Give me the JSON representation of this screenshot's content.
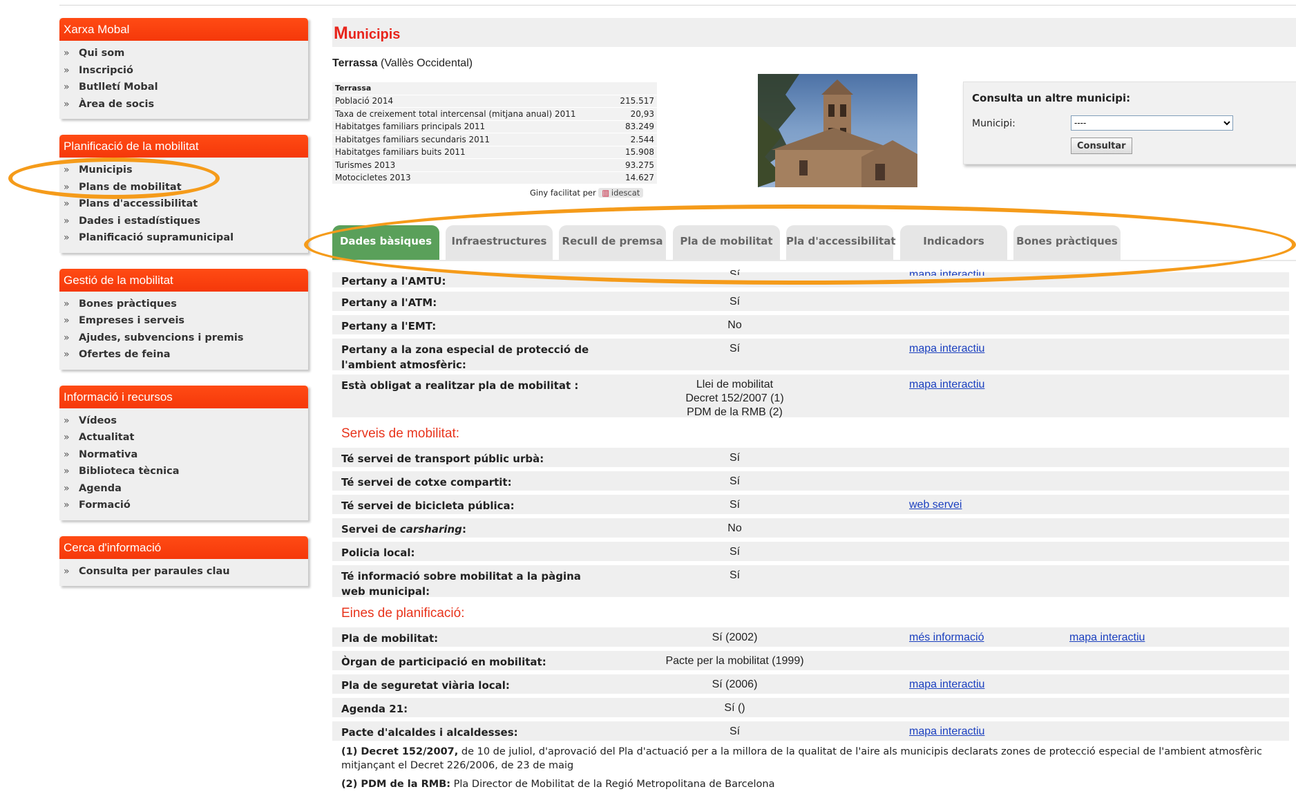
{
  "sidebar": [
    {
      "title": "Xarxa Mobal",
      "items": [
        "Qui som",
        "Inscripció",
        "Butlletí Mobal",
        "Àrea de socis"
      ]
    },
    {
      "title": "Planificació de la mobilitat",
      "items": [
        "Municipis",
        "Plans de mobilitat",
        "Plans d'accessibilitat",
        "Dades i estadístiques",
        "Planificació supramunicipal"
      ]
    },
    {
      "title": "Gestió de la mobilitat",
      "items": [
        "Bones pràctiques",
        "Empreses i serveis",
        "Ajudes, subvencions i premis",
        "Ofertes de feina"
      ]
    },
    {
      "title": "Informació i recursos",
      "items": [
        "Vídeos",
        "Actualitat",
        "Normativa",
        "Biblioteca tècnica",
        "Agenda",
        "Formació"
      ]
    },
    {
      "title": "Cerca d'informació",
      "items": [
        "Consulta per paraules clau"
      ]
    }
  ],
  "header": {
    "first": "M",
    "rest": "unicipis"
  },
  "municipality": {
    "name": "Terrassa",
    "region": "(Vallès Occidental)"
  },
  "stats": {
    "heading": "Terrassa",
    "rows": [
      {
        "label": "Població 2014",
        "value": "215.517"
      },
      {
        "label": "Taxa de creixement total intercensal (mitjana anual) 2011",
        "value": "20,93"
      },
      {
        "label": "Habitatges familiars principals 2011",
        "value": "83.249"
      },
      {
        "label": "Habitatges familiars secundaris 2011",
        "value": "2.544"
      },
      {
        "label": "Habitatges familiars buits 2011",
        "value": "15.908"
      },
      {
        "label": "Turismes 2013",
        "value": "93.275"
      },
      {
        "label": "Motocicletes 2013",
        "value": "14.627"
      }
    ],
    "credit": "Giny facilitat per",
    "credit_logo": "idescat"
  },
  "consulta": {
    "title": "Consulta un altre municipi:",
    "label": "Municipi:",
    "selected": "----",
    "button": "Consultar"
  },
  "tabs": [
    {
      "label": "Dades bàsiques",
      "active": true
    },
    {
      "label": "Infraestructures",
      "active": false
    },
    {
      "label": "Recull de premsa",
      "active": false
    },
    {
      "label": "Pla de mobilitat",
      "active": false
    },
    {
      "label": "Pla d'accessibilitat",
      "active": false
    },
    {
      "label": "Indicadors",
      "active": false
    },
    {
      "label": "Bones pràctiques",
      "active": false
    }
  ],
  "sections": [
    {
      "title": "",
      "rows": [
        {
          "label": "Pertany a l'AMTU:",
          "value": "Sí",
          "links": [
            "mapa interactiu"
          ]
        },
        {
          "label": "Pertany a l'ATM:",
          "value": "Sí",
          "links": []
        },
        {
          "label": "Pertany a l'EMT:",
          "value": "No",
          "links": []
        },
        {
          "label": "Pertany a la zona especial de protecció de l'ambient atmosfèric:",
          "value": "Sí",
          "links": [
            "mapa interactiu"
          ]
        },
        {
          "label": "Està obligat a realitzar pla de mobilitat :",
          "value": "Llei de mobilitat\nDecret 152/2007 (1)\nPDM de la RMB (2)",
          "links": [
            "mapa interactiu"
          ]
        }
      ]
    },
    {
      "title": "Serveis de mobilitat:",
      "rows": [
        {
          "label": "Té servei de transport públic urbà:",
          "value": "Sí",
          "links": []
        },
        {
          "label": "Té servei de cotxe compartit:",
          "value": "Sí",
          "links": []
        },
        {
          "label": "Té servei de bicicleta pública:",
          "value": "Sí",
          "links": [
            "web servei"
          ]
        },
        {
          "label": "Servei de carsharing:",
          "value": "No",
          "links": []
        },
        {
          "label": "Policia local:",
          "value": "Sí",
          "links": []
        },
        {
          "label": "Té informació sobre mobilitat a la pàgina web municipal:",
          "value": "Sí",
          "links": []
        }
      ]
    },
    {
      "title": "Eines de planificació:",
      "rows": [
        {
          "label": "Pla de mobilitat:",
          "value": "Sí (2002)",
          "links": [
            "més informació",
            "mapa interactiu"
          ]
        },
        {
          "label": "Òrgan de participació en mobilitat:",
          "value": "Pacte per la mobilitat (1999)",
          "links": []
        },
        {
          "label": "Pla de seguretat viària local:",
          "value": "Sí (2006)",
          "links": [
            "mapa interactiu"
          ]
        },
        {
          "label": "Agenda 21:",
          "value": "Sí ()",
          "links": []
        },
        {
          "label": "Pacte d'alcaldes i alcaldesses:",
          "value": "Sí",
          "links": [
            "mapa interactiu"
          ]
        }
      ]
    }
  ],
  "notes": [
    {
      "bold": "(1) Decret 152/2007,",
      "text": " de 10 de juliol, d'aprovació del Pla d'actuació per a la millora de la qualitat de l'aire als municipis declarats zones de protecció especial de l'ambient atmosfèric mitjançant el Decret 226/2006, de 23 de maig"
    },
    {
      "bold": "(2) PDM de la RMB:",
      "text": " Pla Director de Mobilitat de la Regió Metropolitana de Barcelona"
    }
  ],
  "colors": {
    "accent": "#f5380a",
    "tab_active": "#5aa05a",
    "annotation": "#f59b1a",
    "link": "#1a3fbf"
  }
}
